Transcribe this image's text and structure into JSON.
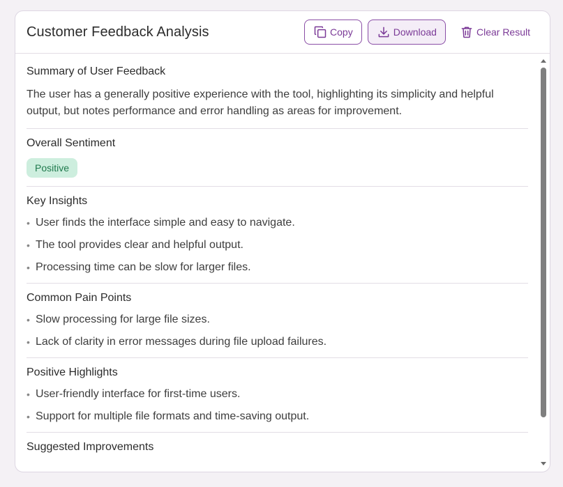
{
  "header": {
    "title": "Customer Feedback Analysis",
    "copy_label": "Copy",
    "download_label": "Download",
    "clear_label": "Clear Result"
  },
  "colors": {
    "accent": "#7b3a97",
    "badge_bg": "#cdeede",
    "badge_text": "#1f7a4d"
  },
  "summary": {
    "title": "Summary of User Feedback",
    "text": "The user has a generally positive experience with the tool, highlighting its simplicity and helpful output, but notes performance and error handling as areas for improvement."
  },
  "sentiment": {
    "title": "Overall Sentiment",
    "value": "Positive"
  },
  "insights": {
    "title": "Key Insights",
    "items": [
      "User finds the interface simple and easy to navigate.",
      "The tool provides clear and helpful output.",
      "Processing time can be slow for larger files."
    ]
  },
  "pain_points": {
    "title": "Common Pain Points",
    "items": [
      "Slow processing for large file sizes.",
      "Lack of clarity in error messages during file upload failures."
    ]
  },
  "highlights": {
    "title": "Positive Highlights",
    "items": [
      "User-friendly interface for first-time users.",
      "Support for multiple file formats and time-saving output."
    ]
  },
  "improvements": {
    "title": "Suggested Improvements"
  },
  "icons": {
    "copy": "copy-icon",
    "download": "download-icon",
    "clear": "trash-icon"
  }
}
